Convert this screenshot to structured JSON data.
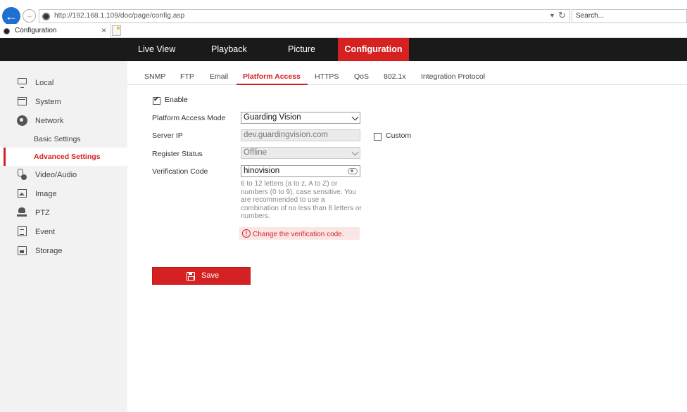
{
  "browser": {
    "url": "http://192.168.1.109/doc/page/config.asp",
    "search_placeholder": "Search...",
    "tab_title": "Configuration",
    "tab_close": "×"
  },
  "nav": {
    "items": [
      {
        "label": "Live View"
      },
      {
        "label": "Playback"
      },
      {
        "label": "Picture"
      },
      {
        "label": "Configuration",
        "active": true
      }
    ]
  },
  "sidebar": {
    "items": [
      {
        "label": "Local",
        "icon": "monitor-icon"
      },
      {
        "label": "System",
        "icon": "system-icon"
      },
      {
        "label": "Network",
        "icon": "globe-icon"
      },
      {
        "label": "Basic Settings"
      },
      {
        "label": "Advanced Settings",
        "active": true
      },
      {
        "label": "Video/Audio",
        "icon": "video-audio-icon"
      },
      {
        "label": "Image",
        "icon": "image-icon"
      },
      {
        "label": "PTZ",
        "icon": "ptz-icon"
      },
      {
        "label": "Event",
        "icon": "event-icon"
      },
      {
        "label": "Storage",
        "icon": "storage-icon"
      }
    ]
  },
  "subtabs": [
    {
      "label": "SNMP"
    },
    {
      "label": "FTP"
    },
    {
      "label": "Email"
    },
    {
      "label": "Platform Access",
      "active": true
    },
    {
      "label": "HTTPS"
    },
    {
      "label": "QoS"
    },
    {
      "label": "802.1x"
    },
    {
      "label": "Integration Protocol"
    }
  ],
  "form": {
    "enable_label": "Enable",
    "enable_checked": true,
    "mode_label": "Platform Access Mode",
    "mode_value": "Guarding Vision",
    "server_ip_label": "Server IP",
    "server_ip_value": "dev.guardingvision.com",
    "custom_label": "Custom",
    "custom_checked": false,
    "register_label": "Register Status",
    "register_value": "Offline",
    "verification_label": "Verification Code",
    "verification_value": "hinovision",
    "hint": "6 to 12 letters (a to z, A to Z) or numbers (0 to 9), case sensitive. You are recommended to use a combination of no less than 8 letters or numbers.",
    "warning": "Change the verification code.",
    "warning_icon": "!",
    "save_label": "Save"
  },
  "colors": {
    "accent": "#d52121",
    "header_bg": "#1a1a1a",
    "sidebar_bg": "#f2f2f2"
  }
}
